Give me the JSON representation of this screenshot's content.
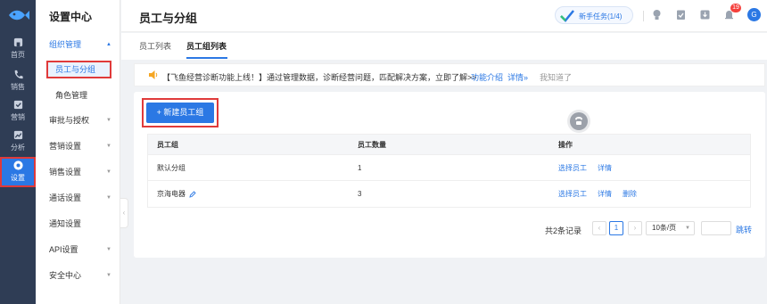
{
  "rail": {
    "items": [
      {
        "label": "首页",
        "icon": "home-icon"
      },
      {
        "label": "销售",
        "icon": "phone-icon"
      },
      {
        "label": "营销",
        "icon": "marketing-icon"
      },
      {
        "label": "分析",
        "icon": "chart-icon"
      },
      {
        "label": "设置",
        "icon": "gear-icon"
      }
    ]
  },
  "menu": {
    "title": "设置中心",
    "org": "组织管理",
    "org_sub": [
      "员工与分组",
      "角色管理"
    ],
    "items": [
      "审批与授权",
      "营销设置",
      "销售设置",
      "通话设置",
      "通知设置",
      "API设置",
      "安全中心"
    ]
  },
  "header": {
    "title": "员工与分组",
    "task_label": "新手任务(1/4)",
    "badge_count": "19",
    "avatar": "G"
  },
  "tabs": [
    "员工列表",
    "员工组列表"
  ],
  "notice": {
    "text": "【飞鱼经营诊断功能上线！】通过管理数据，诊断经营问题，匹配解决方案，立即了解>>",
    "link_intro": "功能介绍",
    "link_detail": "详情»",
    "dismiss": "我知道了"
  },
  "main": {
    "add_button": "+ 新建员工组",
    "columns": [
      "员工组",
      "员工数量",
      "操作"
    ],
    "rows": [
      {
        "group": "默认分组",
        "count": "1",
        "actions": [
          "选择员工",
          "详情"
        ]
      },
      {
        "group": "京海电器",
        "count": "3",
        "actions": [
          "选择员工",
          "详情",
          "删除"
        ]
      }
    ]
  },
  "pagination": {
    "total": "共2条记录",
    "prev": "‹",
    "page": "1",
    "next": "›",
    "page_size": "10条/页",
    "jump": "跳转"
  },
  "colors": {
    "accent": "#2b78e4",
    "rail_bg": "#2f3d55",
    "highlight": "#e03a3a",
    "badge": "#f5413d"
  }
}
